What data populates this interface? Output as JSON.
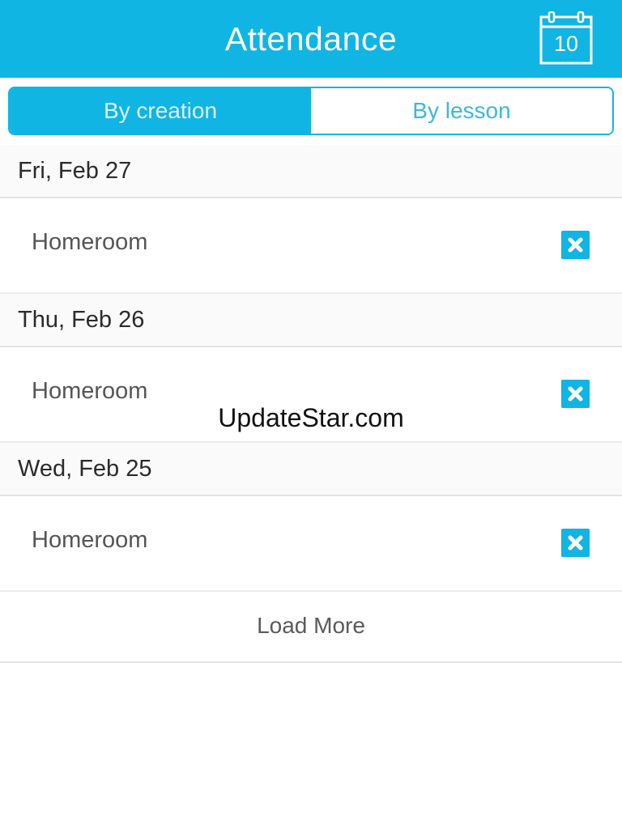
{
  "header": {
    "title": "Attendance",
    "calendar_day": "10",
    "calendar_icon": "calendar-icon"
  },
  "tabs": [
    {
      "label": "By creation",
      "active": true
    },
    {
      "label": "By lesson",
      "active": false
    }
  ],
  "groups": [
    {
      "date": "Fri, Feb 27",
      "items": [
        {
          "label": "Homeroom",
          "icon": "close-icon"
        }
      ]
    },
    {
      "date": "Thu, Feb 26",
      "items": [
        {
          "label": "Homeroom",
          "icon": "close-icon"
        }
      ]
    },
    {
      "date": "Wed, Feb 25",
      "items": [
        {
          "label": "Homeroom",
          "icon": "close-icon"
        }
      ]
    }
  ],
  "load_more": "Load More",
  "watermark": "UpdateStar.com",
  "colors": {
    "accent": "#10b5e3",
    "section_bg": "#fafafa",
    "divider": "#e3e3e3"
  }
}
